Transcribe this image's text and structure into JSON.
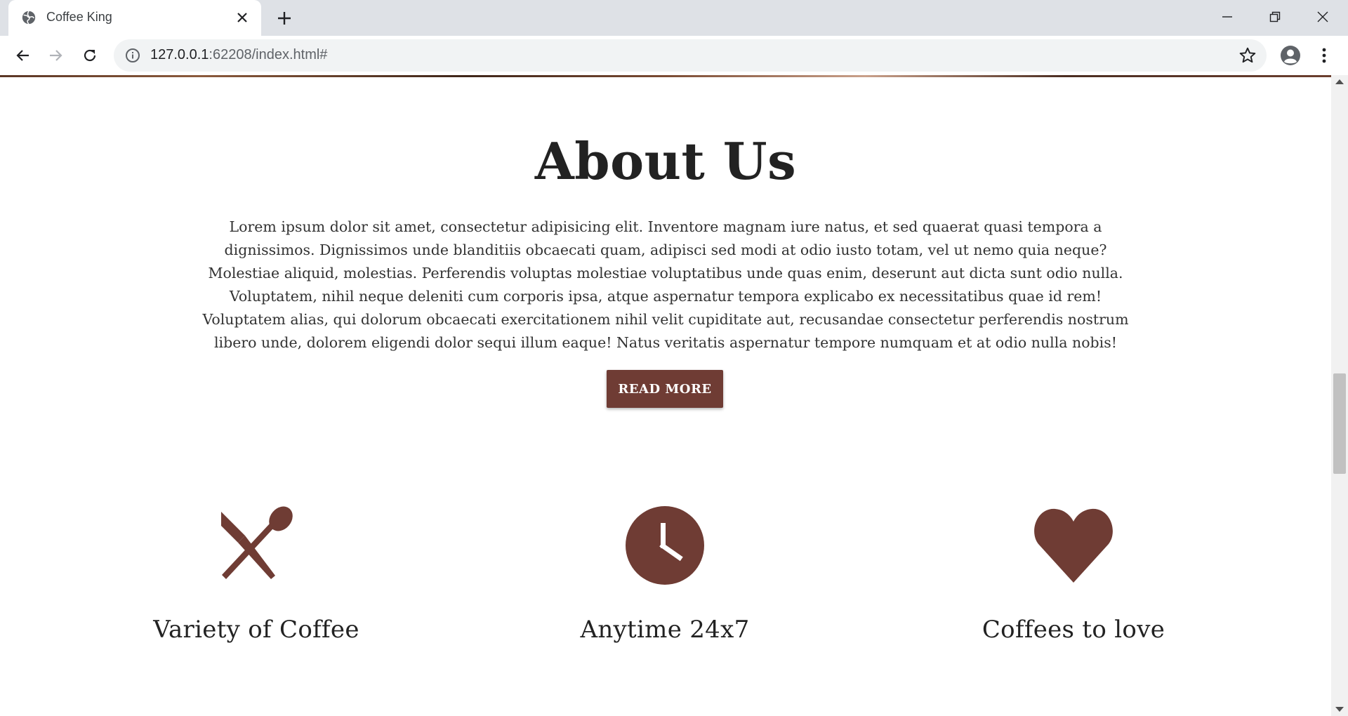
{
  "browser": {
    "tab_title": "Coffee King",
    "url_host": "127.0.0.1",
    "url_path": ":62208/index.html#"
  },
  "about": {
    "title": "About Us",
    "body": "Lorem ipsum dolor sit amet, consectetur adipisicing elit. Inventore magnam iure natus, et sed quaerat quasi tempora a dignissimos. Dignissimos unde blanditiis obcaecati quam, adipisci sed modi at odio iusto totam, vel ut nemo quia neque? Molestiae aliquid, molestias. Perferendis voluptas molestiae voluptatibus unde quas enim, deserunt aut dicta sunt odio nulla. Voluptatem, nihil neque deleniti cum corporis ipsa, atque aspernatur tempora explicabo ex necessitatibus quae id rem! Voluptatem alias, qui dolorum obcaecati exercitationem nihil velit cupiditate aut, recusandae consectetur perferendis nostrum libero unde, dolorem eligendi dolor sequi illum eaque! Natus veritatis aspernatur tempore numquam et at odio nulla nobis!",
    "button_label": "READ MORE"
  },
  "features": [
    {
      "icon": "utensils-icon",
      "label": "Variety of Coffee"
    },
    {
      "icon": "clock-icon",
      "label": "Anytime 24x7"
    },
    {
      "icon": "heart-icon",
      "label": "Coffees to love"
    }
  ],
  "colors": {
    "accent": "#6f3c34",
    "text": "#222222"
  }
}
